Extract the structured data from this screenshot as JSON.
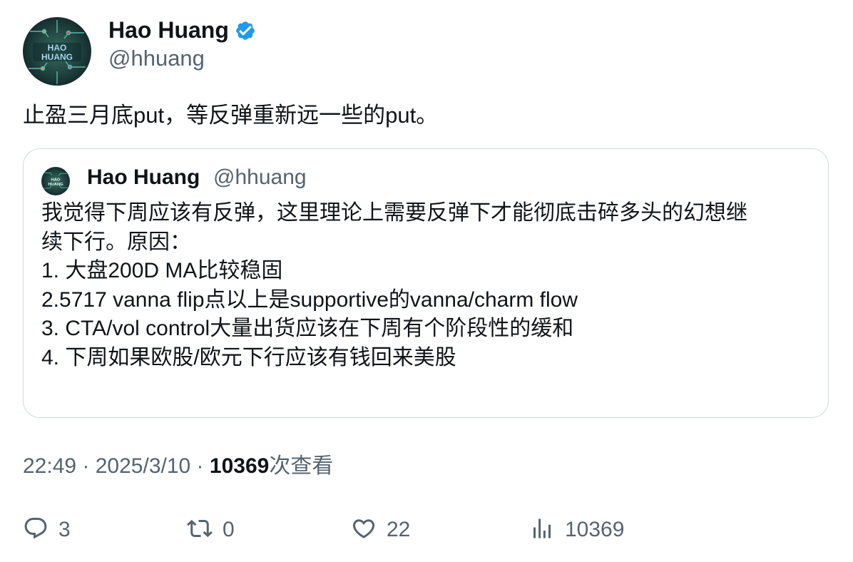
{
  "author": {
    "display_name": "Hao Huang",
    "handle": "@hhuang",
    "avatar_text": [
      "HAO",
      "HUANG"
    ],
    "verified": true
  },
  "tweet": {
    "text": "止盈三月底put，等反弹重新远一些的put。"
  },
  "quote": {
    "display_name": "Hao Huang",
    "handle": "@hhuang",
    "lines": [
      "我觉得下周应该有反弹，这里理论上需要反弹下才能彻底击碎多头的幻想继",
      "续下行。原因：",
      "1. 大盘200D MA比较稳固",
      "2.5717 vanna flip点以上是supportive的vanna/charm flow",
      "3. CTA/vol control大量出货应该在下周有个阶段性的缓和",
      "4. 下周如果欧股/欧元下行应该有钱回来美股"
    ]
  },
  "meta": {
    "time": "22:49",
    "separator": " · ",
    "date": "2025/3/10",
    "views_count": "10369",
    "views_label": "次查看"
  },
  "actions": {
    "replies": "3",
    "reposts": "0",
    "likes": "22",
    "views": "10369"
  },
  "icons": {
    "verified": "verified-badge-icon",
    "reply": "reply-icon",
    "repost": "repost-icon",
    "like": "heart-icon",
    "views": "bar-chart-icon"
  },
  "colors": {
    "verified_blue": "#1d9bf0",
    "text_primary": "#0f1419",
    "text_secondary": "#536471",
    "border": "#cfd9de"
  }
}
